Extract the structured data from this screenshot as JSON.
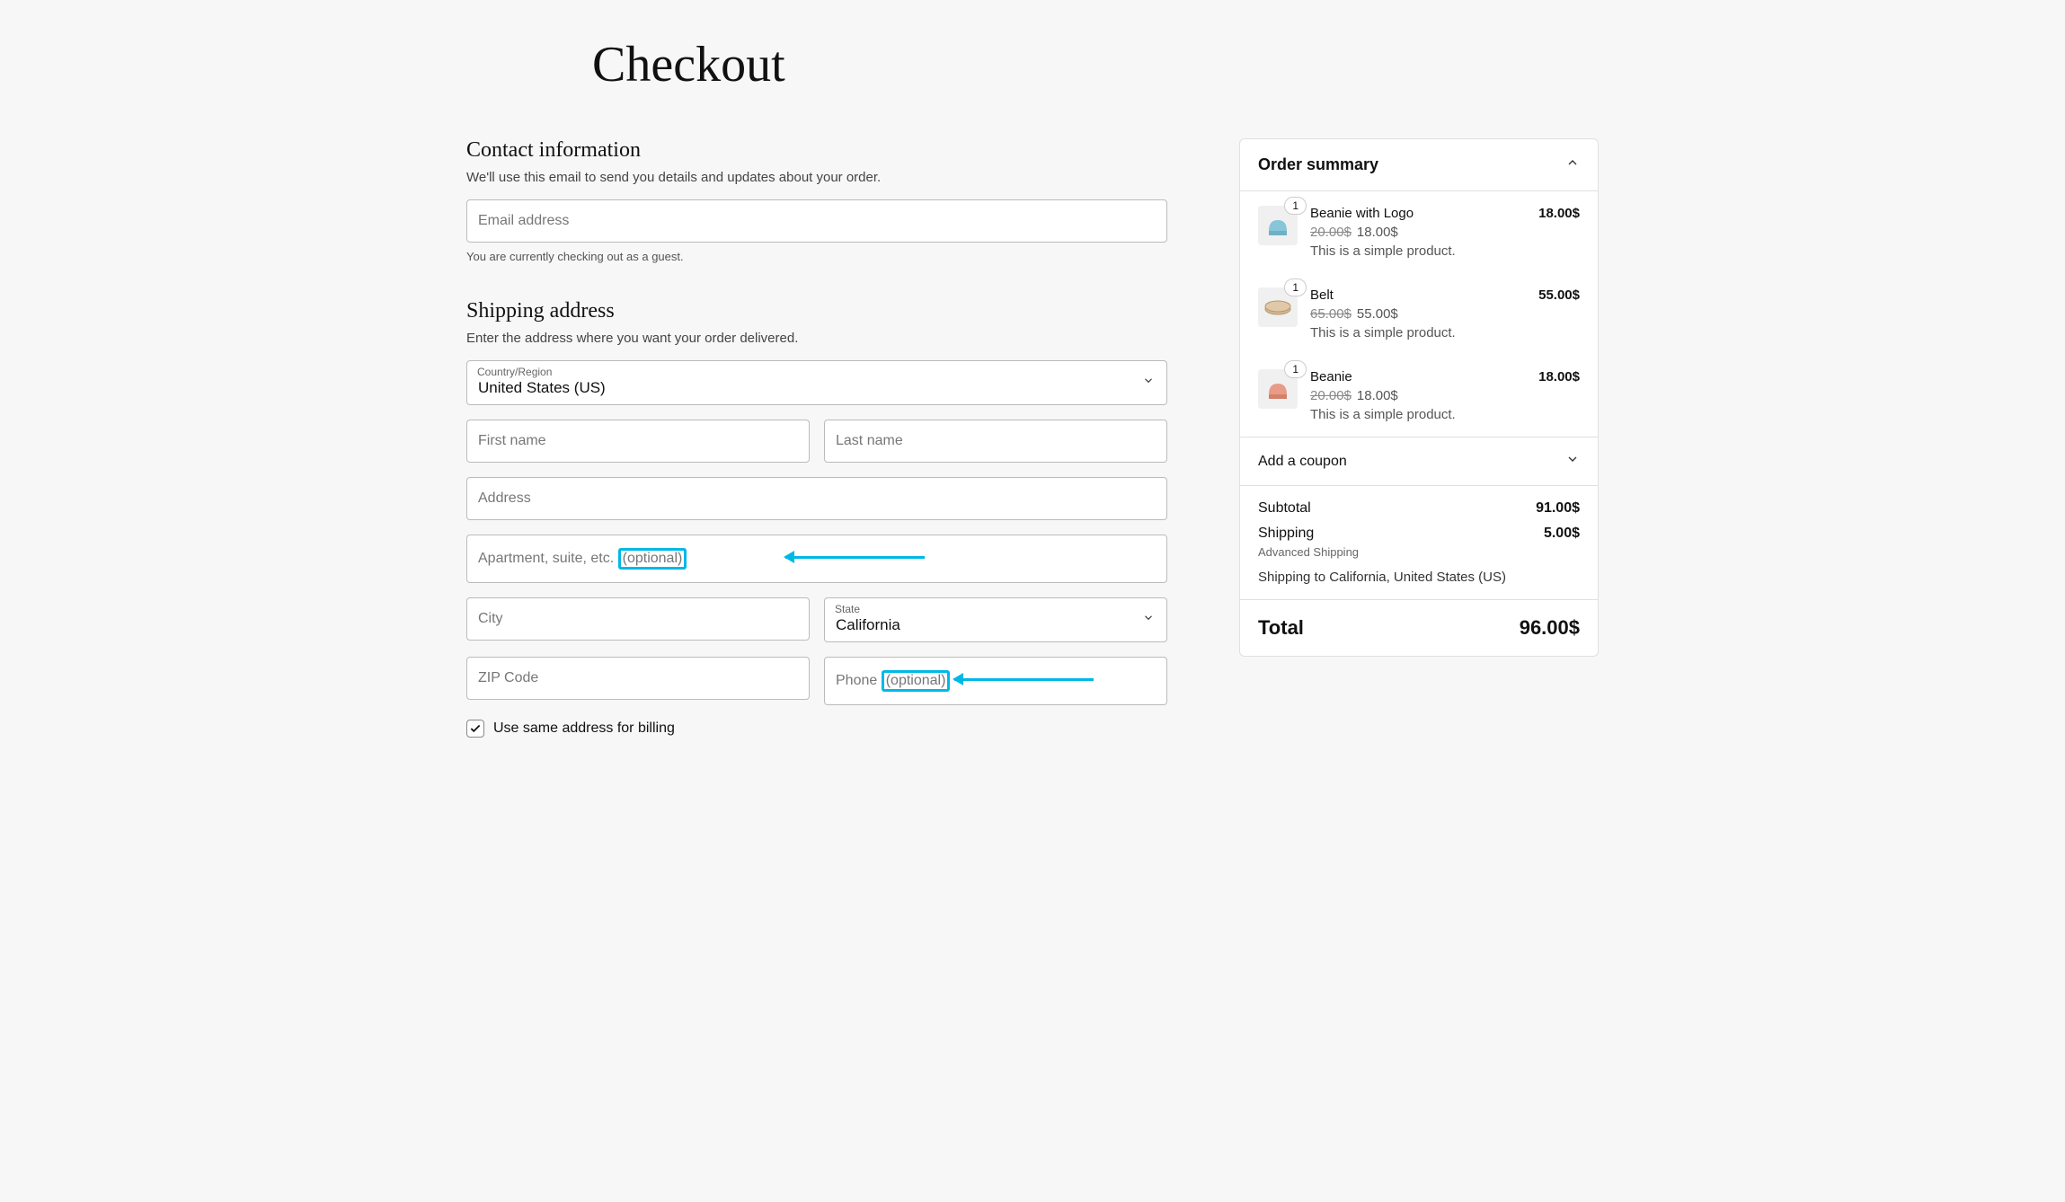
{
  "page": {
    "title": "Checkout"
  },
  "contact": {
    "heading": "Contact information",
    "desc": "We'll use this email to send you details and updates about your order.",
    "email_placeholder": "Email address",
    "guest_note": "You are currently checking out as a guest."
  },
  "shipping": {
    "heading": "Shipping address",
    "desc": "Enter the address where you want your order delivered.",
    "country_label": "Country/Region",
    "country_value": "United States (US)",
    "first_name_placeholder": "First name",
    "last_name_placeholder": "Last name",
    "address_placeholder": "Address",
    "apt_placeholder_main": "Apartment, suite, etc. ",
    "apt_placeholder_opt": "(optional)",
    "city_placeholder": "City",
    "state_label": "State",
    "state_value": "California",
    "zip_placeholder": "ZIP Code",
    "phone_placeholder_main": "Phone ",
    "phone_placeholder_opt": "(optional)",
    "same_billing_label": "Use same address for billing",
    "same_billing_checked": true
  },
  "summary": {
    "title": "Order summary",
    "items": [
      {
        "qty": "1",
        "name": "Beanie with Logo",
        "line_total": "18.00$",
        "orig_price": "20.00$",
        "sale_price": "18.00$",
        "desc": "This is a simple product.",
        "thumb_color": "#87c5d8"
      },
      {
        "qty": "1",
        "name": "Belt",
        "line_total": "55.00$",
        "orig_price": "65.00$",
        "sale_price": "55.00$",
        "desc": "This is a simple product.",
        "thumb_color": "#d4b896"
      },
      {
        "qty": "1",
        "name": "Beanie",
        "line_total": "18.00$",
        "orig_price": "20.00$",
        "sale_price": "18.00$",
        "desc": "This is a simple product.",
        "thumb_color": "#e89b87"
      }
    ],
    "coupon_label": "Add a coupon",
    "subtotal_label": "Subtotal",
    "subtotal_value": "91.00$",
    "shipping_label": "Shipping",
    "shipping_value": "5.00$",
    "shipping_note": "Advanced Shipping",
    "shipping_dest": "Shipping to California, United States (US)",
    "total_label": "Total",
    "total_value": "96.00$"
  }
}
